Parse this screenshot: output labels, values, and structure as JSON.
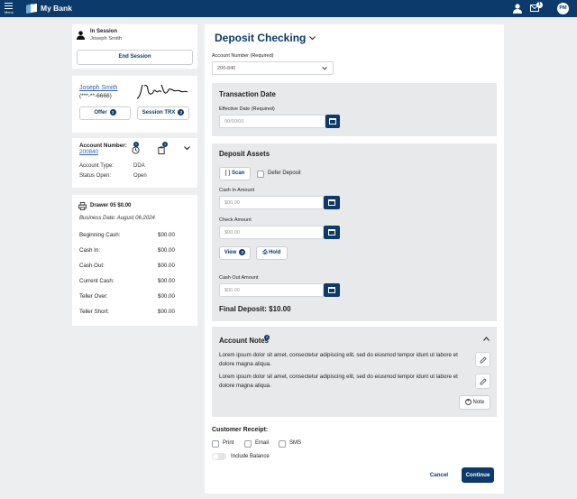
{
  "topbar": {
    "menu_label": "Menu",
    "brand": "My Bank",
    "mail_count": "1",
    "avatar_initials": "PM"
  },
  "session": {
    "title": "In Session",
    "name": "Joseph Smith",
    "end_button": "End Session"
  },
  "customer": {
    "name": "Joseph Smith",
    "masked_id": "(***-**-6666)",
    "offer_label": "Offer",
    "offer_count": "1",
    "session_trx_label": "Session TRX",
    "session_trx_count": "2"
  },
  "account": {
    "number_label": "Account Number:",
    "number": "200840",
    "history_count": "1",
    "clipboard_count": "1",
    "type_label": "Account Type:",
    "type_value": "DDA",
    "status_label": "Status Open:",
    "status_value": "Open"
  },
  "drawer": {
    "title": "Drawer 05 $0.00",
    "business_date": "Business Date: August 06,2024",
    "rows": [
      {
        "label": "Beginning Cash:",
        "value": "$00.00"
      },
      {
        "label": "Cash In:",
        "value": "$00.00"
      },
      {
        "label": "Cash Out:",
        "value": "$00.00"
      },
      {
        "label": "Current Cash:",
        "value": "$00.00"
      },
      {
        "label": "Teller Over:",
        "value": "$00.00"
      },
      {
        "label": "Teller Short:",
        "value": "$00.00"
      }
    ]
  },
  "main": {
    "title": "Deposit Checking",
    "account_number_label": "Account Number (Required)",
    "account_number_value": "200-840",
    "transaction_date": {
      "title": "Transaction Date",
      "effective_label": "Effective Date (Required)",
      "effective_placeholder": "00/00/00"
    },
    "deposit_assets": {
      "title": "Deposit Assets",
      "scan_label": "Scan",
      "defer_label": "Defer Deposit",
      "cash_in_label": "Cash In Amount",
      "cash_in_placeholder": "$00.00",
      "check_label": "Check Amount",
      "check_placeholder": "$00.00",
      "view_label": "View",
      "view_count": "2",
      "hold_label": "Hold",
      "cash_out_label": "Cash Out Amount",
      "cash_out_placeholder": "$00.00",
      "final_deposit": "Final Deposit: $10.00"
    },
    "notes": {
      "title": "Account Notes",
      "count": "2",
      "items": [
        {
          "text_line1": "Lorem ipsum dolor sit amet, consectetur adipiscing elit, sed do eiusmod tempor idunt ut labore et",
          "text_line2": "dolore magna aliqua."
        },
        {
          "text_line1": "Lorem ipsum dolor sit amet, consectetur adipiscing elit, sed do eiusmod tempor idunt ut labore et",
          "text_line2": "dolore magna aliqua."
        }
      ],
      "add_label": "Note"
    },
    "receipt": {
      "title": "Customer Receipt:",
      "print_label": "Print",
      "email_label": "Email",
      "sms_label": "SMS",
      "include_balance_label": "Include Balance"
    },
    "cancel_label": "Cancel",
    "continue_label": "Continue"
  },
  "colors": {
    "primary": "#0b3a6b",
    "panel": "#e8e9eb",
    "background": "#edeef0"
  }
}
